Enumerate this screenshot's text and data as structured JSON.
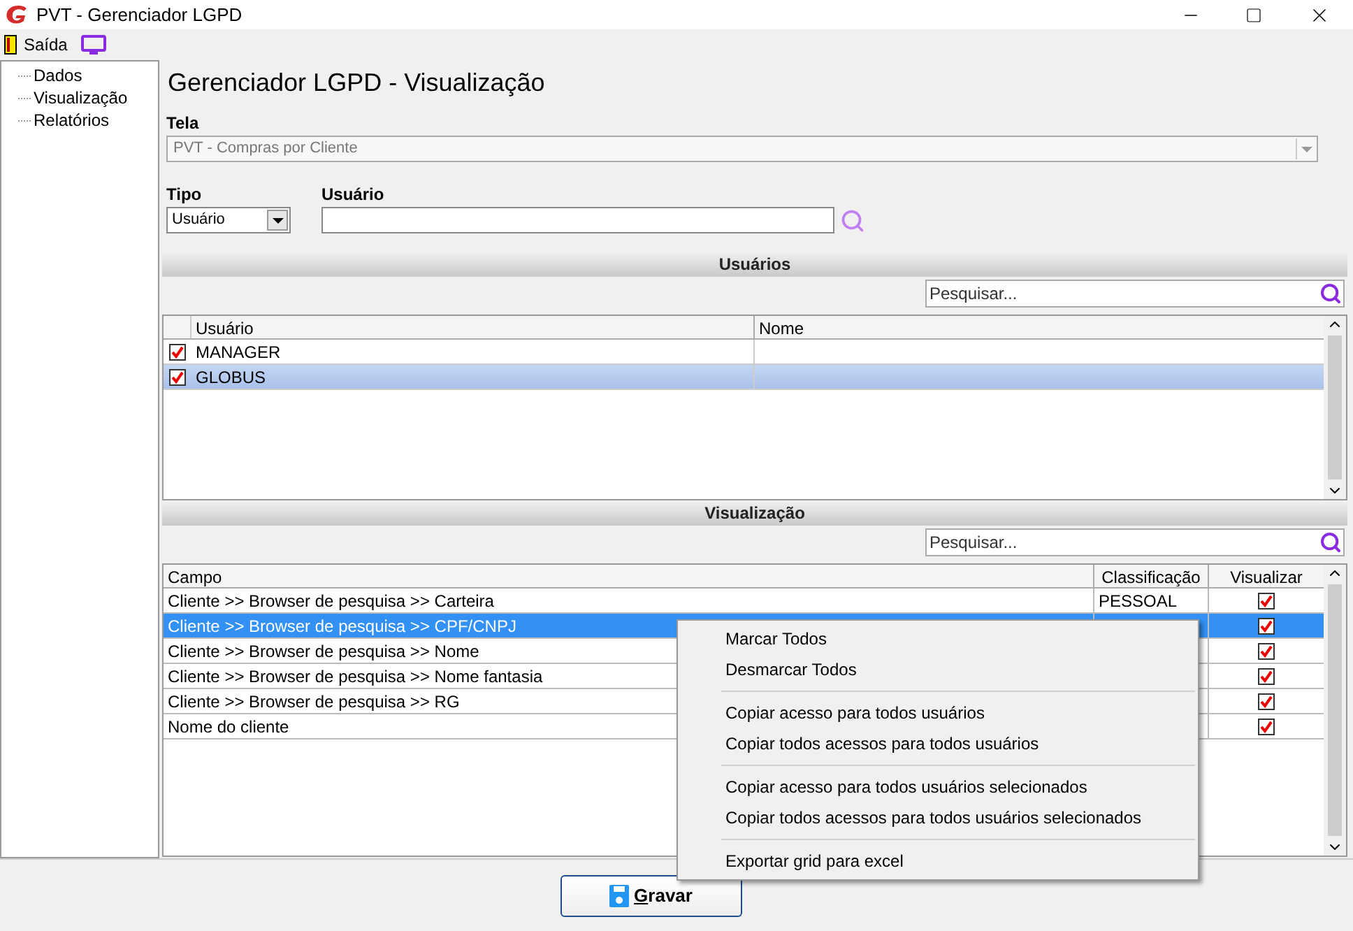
{
  "window": {
    "title": "PVT - Gerenciador LGPD"
  },
  "toolbar": {
    "exit_label": "Saída"
  },
  "sidebar": {
    "items": [
      {
        "label": "Dados"
      },
      {
        "label": "Visualização"
      },
      {
        "label": "Relatórios"
      }
    ]
  },
  "heading": "Gerenciador LGPD - Visualização",
  "tela": {
    "label": "Tela",
    "value": "PVT - Compras por Cliente"
  },
  "tipo": {
    "label": "Tipo",
    "value": "Usuário"
  },
  "usuario": {
    "label": "Usuário"
  },
  "users_section": {
    "title": "Usuários",
    "search_placeholder": "Pesquisar...",
    "columns": [
      "Usuário",
      "Nome"
    ],
    "rows": [
      {
        "checked": true,
        "user": "MANAGER",
        "selected": false
      },
      {
        "checked": true,
        "user": "GLOBUS",
        "selected": true
      }
    ]
  },
  "view_section": {
    "title": "Visualização",
    "search_placeholder": "Pesquisar...",
    "columns": [
      "Campo",
      "Classificação",
      "Visualizar"
    ],
    "rows": [
      {
        "campo": "Cliente >> Browser de pesquisa >> Carteira",
        "classificacao": "PESSOAL",
        "visualizar": true,
        "selected": false
      },
      {
        "campo": "Cliente >> Browser de pesquisa >> CPF/CNPJ",
        "visualizar": true,
        "selected": true
      },
      {
        "campo": "Cliente >> Browser de pesquisa >> Nome",
        "visualizar": true,
        "selected": false
      },
      {
        "campo": "Cliente >> Browser de pesquisa >> Nome fantasia",
        "visualizar": true,
        "selected": false
      },
      {
        "campo": "Cliente >> Browser de pesquisa >> RG",
        "visualizar": true,
        "selected": false
      },
      {
        "campo": "Nome do cliente",
        "visualizar": true,
        "selected": false
      }
    ]
  },
  "context_menu": {
    "groups": [
      [
        "Marcar Todos",
        "Desmarcar Todos"
      ],
      [
        "Copiar acesso para todos usuários",
        "Copiar todos acessos para todos usuários"
      ],
      [
        "Copiar acesso para todos usuários selecionados",
        "Copiar todos acessos para todos usuários selecionados"
      ],
      [
        "Exportar grid para excel"
      ]
    ]
  },
  "save_button": "Gravar"
}
